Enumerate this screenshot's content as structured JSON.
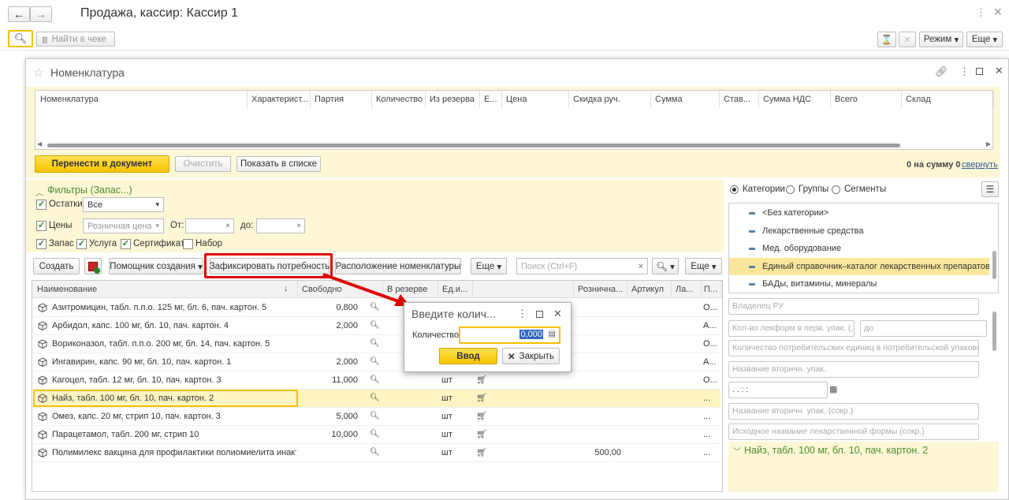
{
  "window": {
    "title": "Продажа, кассир: Кассир 1",
    "search_placeholder": "Найти в чеке",
    "mode_label": "Режим",
    "more_label": "Еще"
  },
  "dialog_main": {
    "title": "Номенклатура",
    "table_headers": [
      "Номенклатура",
      "Характерист...",
      "Партия",
      "Количество",
      "Из резерва",
      "Е...",
      "Цена",
      "Скидка руч.",
      "Сумма",
      "Став...",
      "Сумма НДС",
      "Всего",
      "Склад"
    ],
    "transfer_button": "Перенести в документ",
    "clear_button": "Очистить",
    "show_in_list_button": "Показать в списке",
    "summary": "0 на сумму 0",
    "collapse_link": "свернуть"
  },
  "filters": {
    "title": "Фильтры (Запас...)",
    "remains_label": "Остатки",
    "remains_value": "Все",
    "prices_label": "Цены",
    "price_type_placeholder": "Розничная цена",
    "from_label": "От:",
    "to_label": "до:",
    "stock_label": "Запас",
    "service_label": "Услуга",
    "certificate_label": "Сертификат",
    "set_label": "Набор"
  },
  "toolbar": {
    "create": "Создать",
    "assistant": "Помощник создания",
    "fix_need": "Зафиксировать потребность",
    "location": "Расположение номенклатуры",
    "more": "Еще",
    "search_placeholder": "Поиск (Ctrl+F)",
    "more2": "Еще"
  },
  "grid": {
    "headers": [
      "Наименование",
      "Свободно",
      "В резерве",
      "Ед.и...",
      "Рознична...",
      "Артикул",
      "Ла...",
      "П..."
    ],
    "rows": [
      {
        "name": "Азитромицин, табл. п.п.о. 125 мг, бл. 6, пач. картон. 5",
        "free": "0,800",
        "unit": "",
        "price": "",
        "extra": "О..."
      },
      {
        "name": "Арбидол, капс. 100 мг, бл. 10, пач. картон. 4",
        "free": "2,000",
        "unit": "",
        "price": "",
        "extra": "А..."
      },
      {
        "name": "Вориконазол, табл. п.п.о. 200 мг, бл. 14, пач. картон. 5",
        "free": "",
        "unit": "",
        "price": "",
        "extra": "О..."
      },
      {
        "name": "Ингавирин, капс. 90 мг, бл. 10, пач. картон. 1",
        "free": "2,000",
        "unit": "",
        "price": "",
        "extra": "А..."
      },
      {
        "name": "Кагоцел, табл. 12 мг, бл. 10, пач. картон. 3",
        "free": "11,000",
        "unit": "шт",
        "price": "",
        "extra": "О..."
      },
      {
        "name": "Найз, табл. 100 мг, бл. 10, пач. картон. 2",
        "free": "",
        "unit": "шт",
        "price": "",
        "extra": "..."
      },
      {
        "name": "Омез, капс. 20 мг, стрип 10, пач. картон. 3",
        "free": "5,000",
        "unit": "шт",
        "price": "",
        "extra": "..."
      },
      {
        "name": "Парацетамол, табл. 200 мг, стрип 10",
        "free": "10,000",
        "unit": "шт",
        "price": "",
        "extra": "..."
      },
      {
        "name": "Полимилекс вакцина для профилактики полиомиелита инактив...",
        "free": "",
        "unit": "шт",
        "price": "500,00",
        "extra": "..."
      }
    ]
  },
  "sidebar": {
    "radio_categories": "Категории",
    "radio_groups": "Группы",
    "radio_segments": "Сегменты",
    "categories": [
      "<Без категории>",
      "Лекарственные средства",
      "Мед. оборудование",
      "Единый справочник–каталог лекарственных препаратов (ЕСК",
      "БАДы, витамины, минералы"
    ],
    "fields": [
      "Владелец РУ",
      "Кол-во лекформ в перв. упак. (...",
      "до",
      "Количество потребительских единиц в потребительской упаковке",
      "Название вторичн. упак.",
      ". .    :  :",
      "Название вторичн. упак. (сокр.)",
      "Исходное название лекарственной формы (сокр.)"
    ],
    "selected_item": "Найз, табл. 100 мг, бл. 10, пач. картон. 2"
  },
  "qty_dialog": {
    "title": "Введите колич...",
    "qty_label": "Количество:",
    "qty_value": "0,000",
    "ok_button": "Ввод",
    "close_button": "Закрыть"
  },
  "colors": {
    "accent": "#f6c200",
    "highlight": "#e00000",
    "panel": "#fdf7d6"
  }
}
